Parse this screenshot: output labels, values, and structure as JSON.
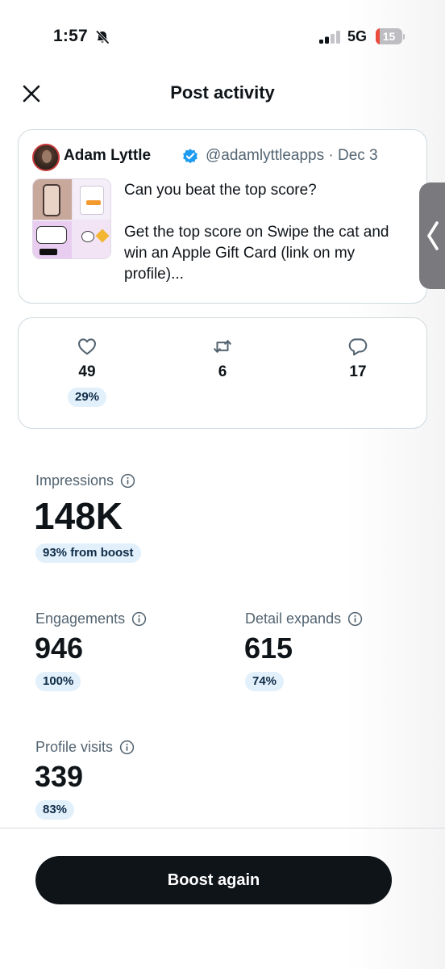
{
  "status_bar": {
    "time": "1:57",
    "network": "5G",
    "battery_level": "15",
    "battery_fraction": 0.15,
    "battery_color": "#eb4d3d"
  },
  "header": {
    "title": "Post activity",
    "close_icon": "close-icon"
  },
  "post": {
    "author_name": "Adam Lyttle",
    "author_handle": "@adamlyttleapps · Dec 3",
    "line1": "Can you beat the top score?",
    "line2": "Get the top score on Swipe the cat and win an Apple Gift Card (link on my profile)..."
  },
  "engagement": {
    "likes": {
      "icon": "heart-icon",
      "value": "49",
      "badge": "29%"
    },
    "reposts": {
      "icon": "repost-icon",
      "value": "6"
    },
    "replies": {
      "icon": "reply-icon",
      "value": "17"
    }
  },
  "stats": {
    "impressions": {
      "label": "Impressions",
      "value": "148K",
      "badge": "93% from boost"
    },
    "engagements": {
      "label": "Engagements",
      "value": "946",
      "badge": "100%"
    },
    "detail_expands": {
      "label": "Detail expands",
      "value": "615",
      "badge": "74%"
    },
    "profile_visits": {
      "label": "Profile visits",
      "value": "339",
      "badge": "83%"
    }
  },
  "actions": {
    "boost_label": "Boost again"
  },
  "colors": {
    "text": "#0f1419",
    "muted": "#536471",
    "border": "#cfd9de",
    "badge_bg": "#e1f0fb",
    "verified": "#1d9bf0",
    "button_bg": "#0f1419"
  }
}
